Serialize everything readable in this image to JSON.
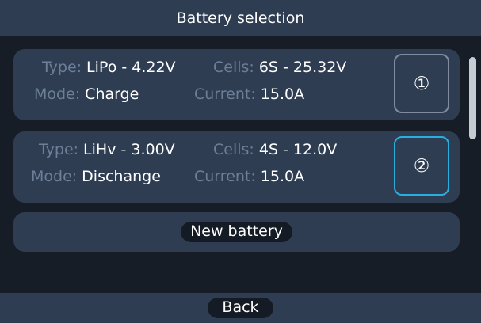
{
  "header": {
    "title": "Battery selection"
  },
  "batteries": [
    {
      "type_label": "Type:",
      "type_value": "LiPo - 4.22V",
      "cells_label": "Cells:",
      "cells_value": "6S - 25.32V",
      "mode_label": "Mode:",
      "mode_value": "Charge",
      "current_label": "Current:",
      "current_value": "15.0A",
      "slot": "①",
      "selected": false
    },
    {
      "type_label": "Type:",
      "type_value": "LiHv - 3.00V",
      "cells_label": "Cells:",
      "cells_value": "4S - 12.0V",
      "mode_label": "Mode:",
      "mode_value": "Dischange",
      "current_label": "Current:",
      "current_value": "15.0A",
      "slot": "②",
      "selected": true
    }
  ],
  "actions": {
    "new_battery": "New battery",
    "back": "Back"
  },
  "colors": {
    "panel": "#2e3d52",
    "background": "#161d27",
    "label": "#6d7f96",
    "accent_selected": "#2aaee0",
    "border_idle": "#7f8ba0"
  }
}
